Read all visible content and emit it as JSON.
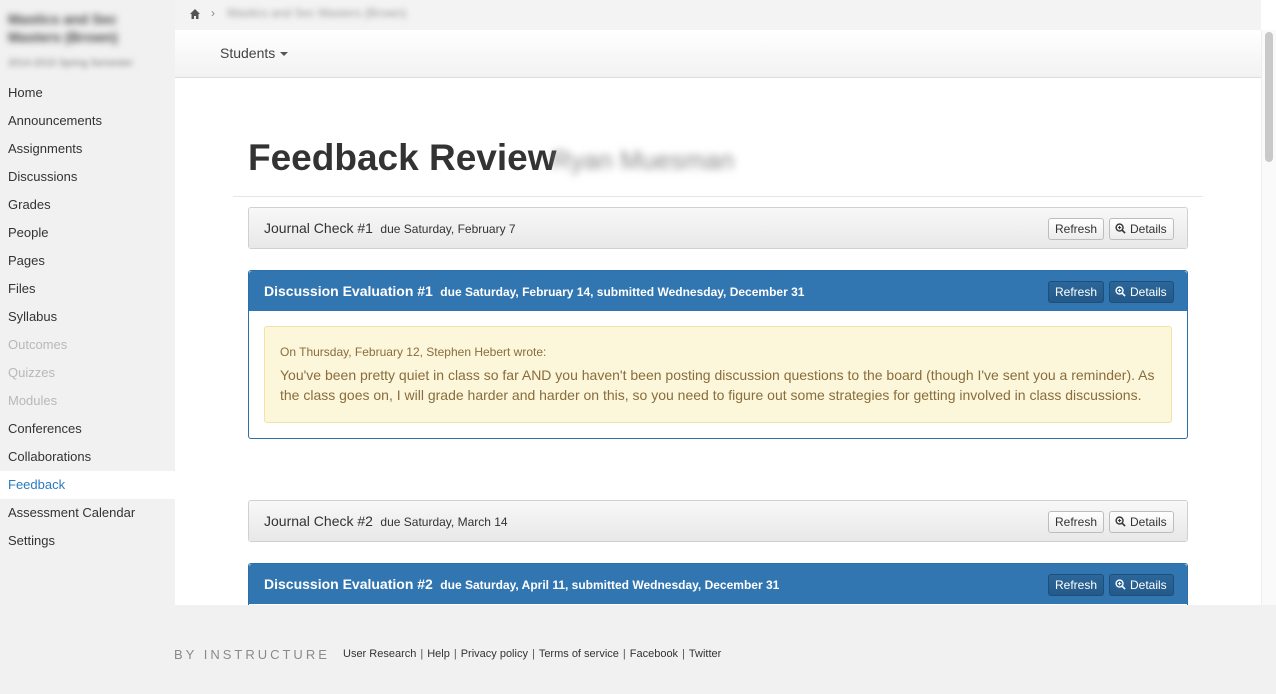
{
  "course": {
    "name": "Mastics and Sec Masters (Brown)",
    "term": "2014-2015 Spring Semester"
  },
  "breadcrumb": {
    "course_link": "Mastics and Sec Masters (Brown)"
  },
  "sidebar": {
    "items": [
      {
        "label": "Home",
        "state": "normal"
      },
      {
        "label": "Announcements",
        "state": "normal"
      },
      {
        "label": "Assignments",
        "state": "normal"
      },
      {
        "label": "Discussions",
        "state": "normal"
      },
      {
        "label": "Grades",
        "state": "normal"
      },
      {
        "label": "People",
        "state": "normal"
      },
      {
        "label": "Pages",
        "state": "normal"
      },
      {
        "label": "Files",
        "state": "normal"
      },
      {
        "label": "Syllabus",
        "state": "normal"
      },
      {
        "label": "Outcomes",
        "state": "disabled"
      },
      {
        "label": "Quizzes",
        "state": "disabled"
      },
      {
        "label": "Modules",
        "state": "disabled"
      },
      {
        "label": "Conferences",
        "state": "normal"
      },
      {
        "label": "Collaborations",
        "state": "normal"
      },
      {
        "label": "Feedback",
        "state": "active"
      },
      {
        "label": "Assessment Calendar",
        "state": "normal"
      },
      {
        "label": "Settings",
        "state": "normal"
      }
    ]
  },
  "subnav": {
    "students_label": "Students"
  },
  "main": {
    "title": "Feedback Review",
    "student_name": "Ryan Muesman",
    "panels": [
      {
        "name": "Journal Check #1",
        "meta": "due Saturday, February 7",
        "style": "default",
        "refresh": "Refresh",
        "details": "Details"
      },
      {
        "name": "Discussion Evaluation #1",
        "meta": "due Saturday, February 14, submitted Wednesday, December 31",
        "style": "primary",
        "refresh": "Refresh",
        "details": "Details",
        "feedback": {
          "attribution": "On Thursday, February 12, Stephen Hebert wrote:",
          "message": "You've been pretty quiet in class so far AND you haven't been posting discussion questions to the board (though I've sent you a reminder). As the class goes on, I will grade harder and harder on this, so you need to figure out some strategies for getting involved in class discussions."
        }
      },
      {
        "name": "Journal Check #2",
        "meta": "due Saturday, March 14",
        "style": "default",
        "refresh": "Refresh",
        "details": "Details"
      },
      {
        "name": "Discussion Evaluation #2",
        "meta": "due Saturday, April 11, submitted Wednesday, December 31",
        "style": "primary",
        "refresh": "Refresh",
        "details": "Details"
      }
    ]
  },
  "footer": {
    "brand": "BY INSTRUCTURE",
    "links": [
      "User Research",
      "Help",
      "Privacy policy",
      "Terms of service",
      "Facebook",
      "Twitter"
    ]
  },
  "colors": {
    "primary": "#3276b1",
    "active_link": "#2a7bc0",
    "alert_bg": "#fcf6db",
    "alert_text": "#8a6d3b"
  }
}
